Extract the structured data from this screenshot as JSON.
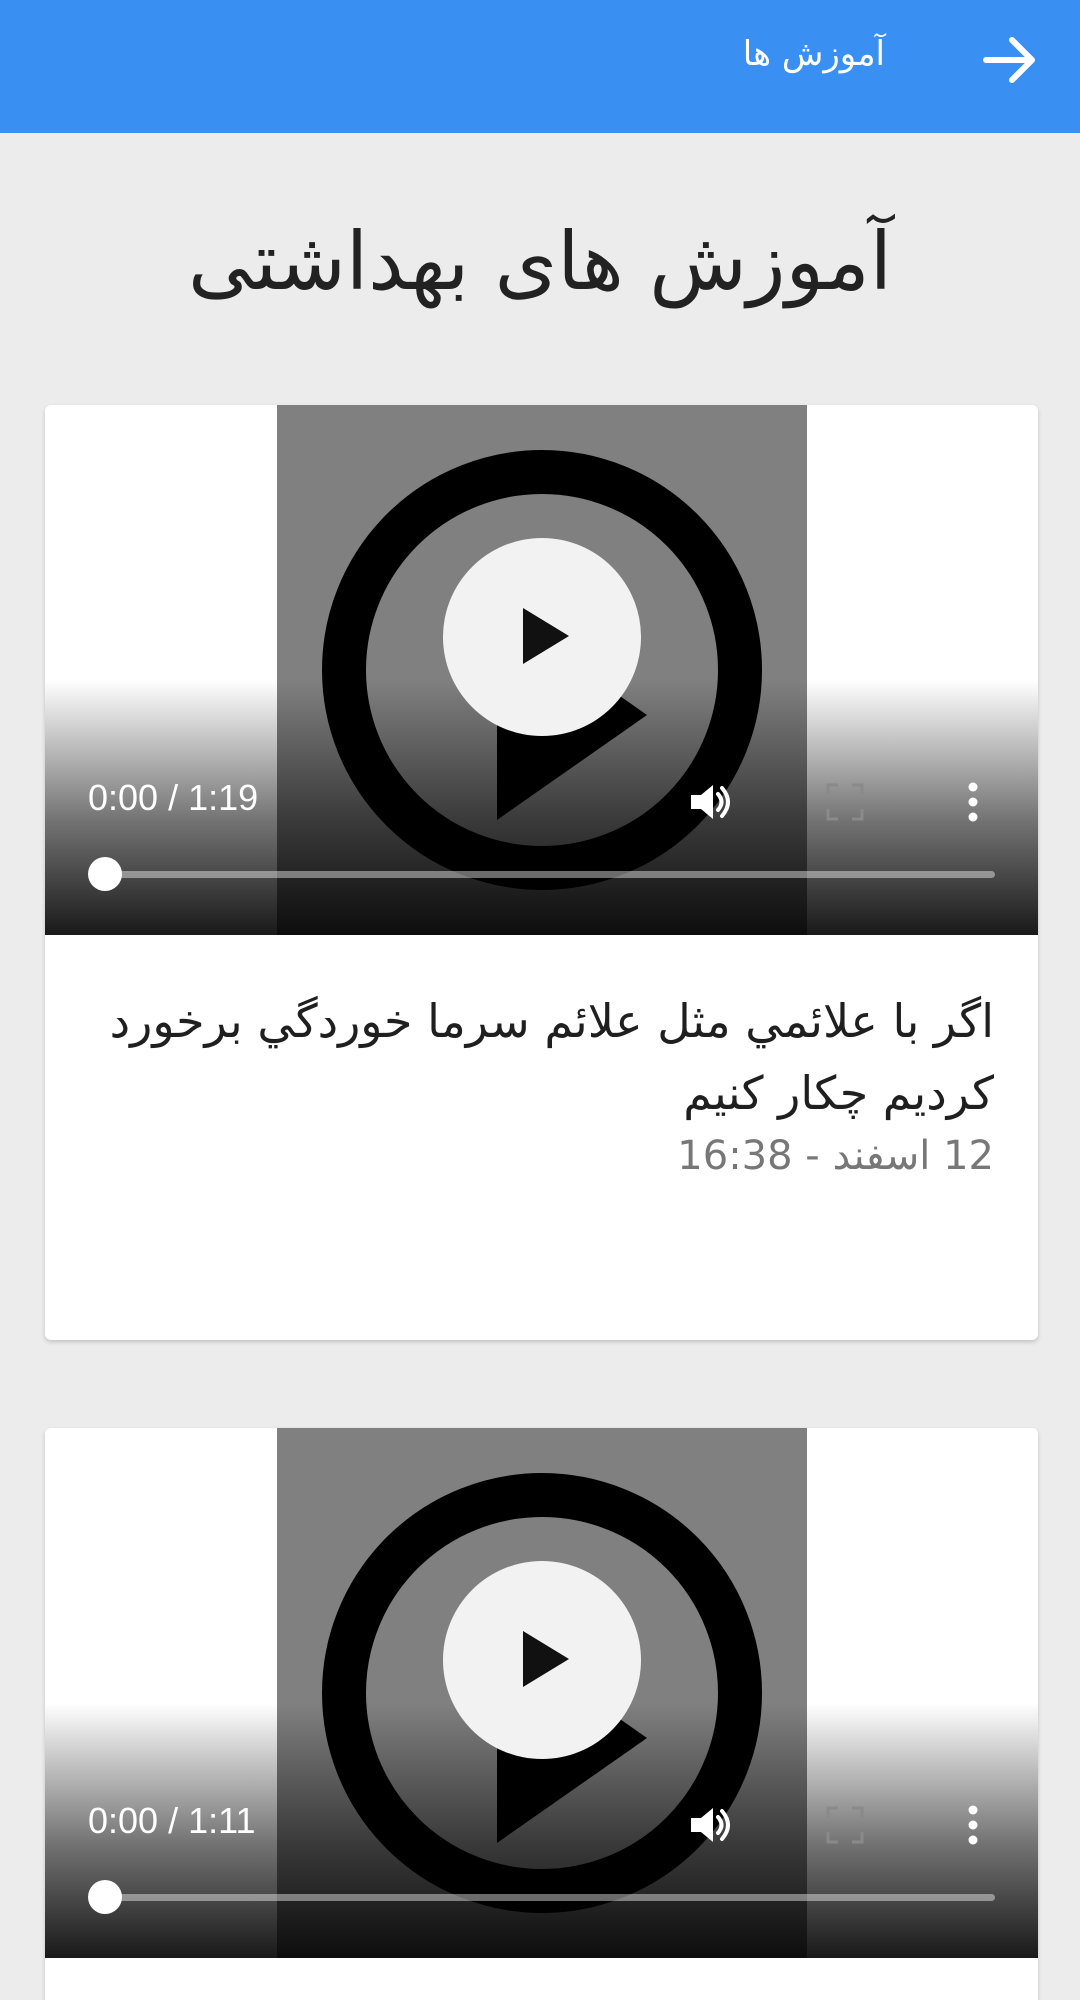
{
  "appbar": {
    "title": "آموزش ها",
    "back_icon": "arrow-right-icon",
    "color": "#3a8ff2"
  },
  "page": {
    "title": "آموزش های بهداشتی"
  },
  "cards": [
    {
      "video": {
        "time": "0:00 / 1:19",
        "progress": 0
      },
      "title": "اگر با علائمي مثل علائم سرما خوردگي برخورد كرديم چكار كنيم",
      "date": "12 اسفند - 16:38"
    },
    {
      "video": {
        "time": "0:00 / 1:11",
        "progress": 0
      }
    }
  ],
  "icons": {
    "play": "play-icon",
    "volume": "volume-icon",
    "fullscreen": "fullscreen-icon",
    "more": "more-vertical-icon"
  }
}
